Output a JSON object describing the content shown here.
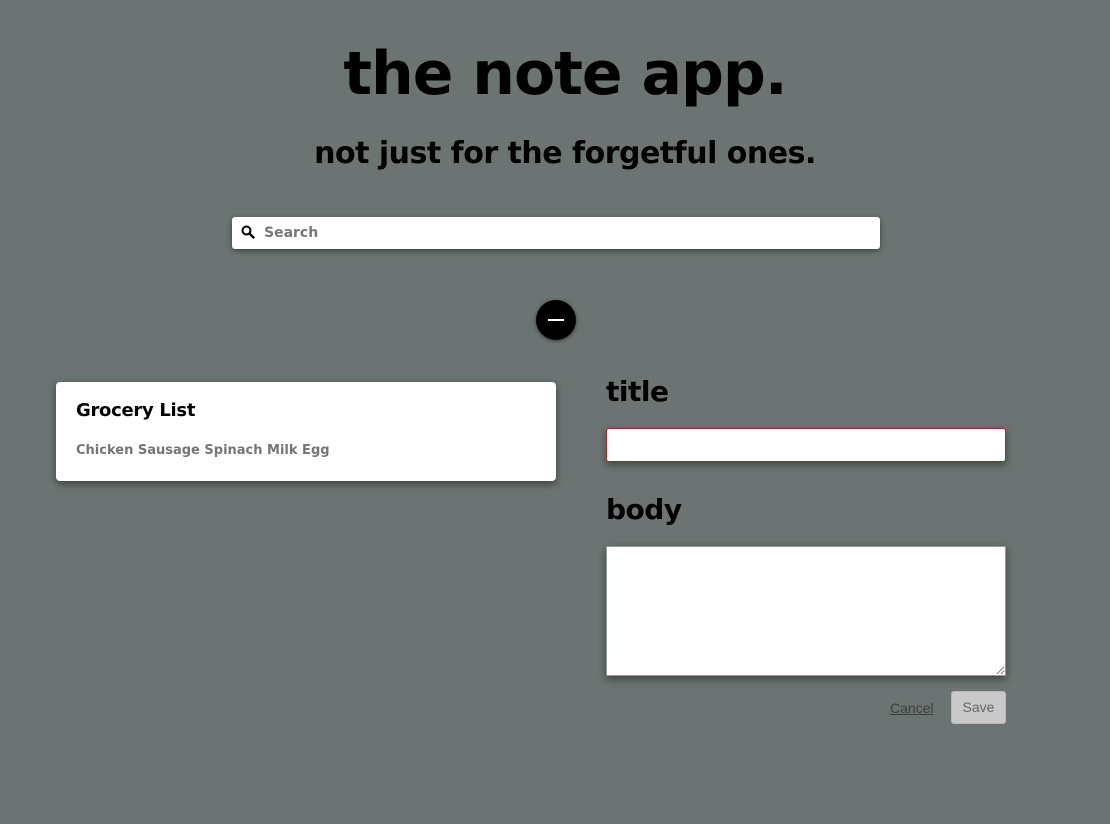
{
  "header": {
    "title": "the note app.",
    "subtitle": "not just for the forgetful ones."
  },
  "search": {
    "placeholder": "Search",
    "value": "",
    "icon": "search-icon"
  },
  "toggle": {
    "icon": "minus-icon"
  },
  "notes": [
    {
      "title": "Grocery List",
      "body": "Chicken Sausage Spinach Milk Egg"
    }
  ],
  "form": {
    "title_label": "title",
    "title_value": "",
    "body_label": "body",
    "body_value": "",
    "cancel_label": "Cancel",
    "save_label": "Save"
  },
  "colors": {
    "background": "#6b7472",
    "card": "#ffffff",
    "invalid_border": "#b22222",
    "save_disabled": "#c9c9c9"
  }
}
